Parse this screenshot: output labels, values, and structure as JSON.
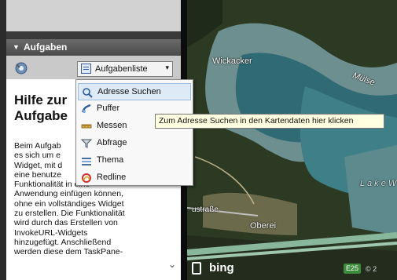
{
  "tasks_panel": {
    "header": "Aufgaben",
    "tasklist_label": "Aufgabenliste"
  },
  "help": {
    "title_lines": [
      "Hilfe zur",
      "Aufgabe"
    ],
    "body_lines": [
      "Beim Aufgab",
      "es sich um e",
      "Widget, mit d",
      "eine benutze",
      "Funktionalität in eine",
      "Anwendung einfügen können,",
      "ohne ein vollständiges Widget",
      "zu erstellen. Die Funktionalität",
      "wird durch das Erstellen von",
      "InvokeURL-Widgets",
      "hinzugefügt. Anschließend",
      "werden diese dem TaskPane-"
    ]
  },
  "menu": {
    "items": [
      {
        "label": "Adresse Suchen",
        "icon": "magnifier-icon"
      },
      {
        "label": "Puffer",
        "icon": "buffer-icon"
      },
      {
        "label": "Messen",
        "icon": "ruler-icon"
      },
      {
        "label": "Abfrage",
        "icon": "filter-icon"
      },
      {
        "label": "Thema",
        "icon": "theme-icon"
      },
      {
        "label": "Redline",
        "icon": "redline-icon"
      }
    ]
  },
  "tooltip": "Zum Adresse Suchen in den Kartendaten hier klicken",
  "map": {
    "labels": {
      "wickacker": "Wickacker",
      "mulse": "Mülse",
      "lake": "L a k e  W",
      "strasse": "ustraße",
      "oberei": "Oberei"
    },
    "bing": "bing",
    "road_shield": "E25",
    "copyright": "© 2"
  }
}
